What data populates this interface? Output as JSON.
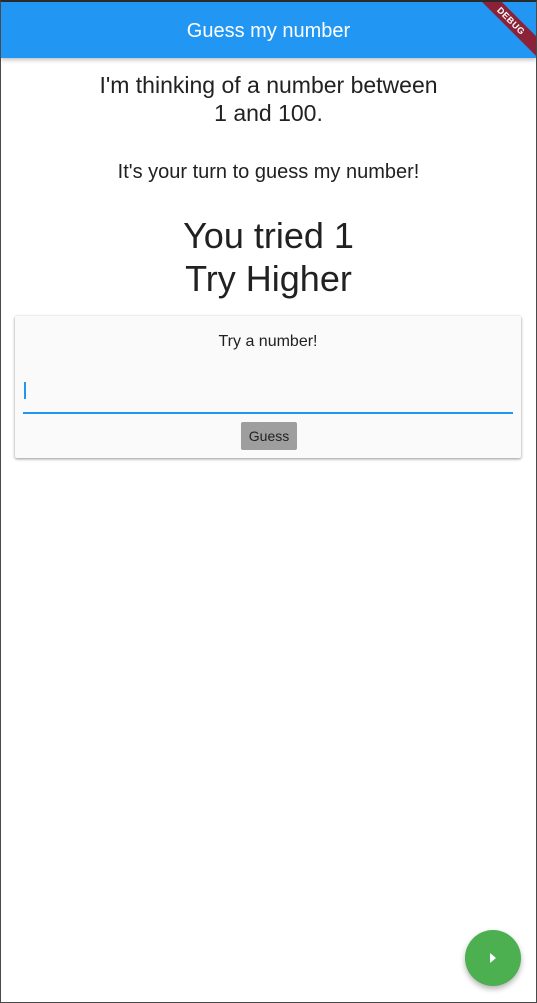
{
  "app_bar": {
    "title": "Guess my number",
    "debug_banner": "DEBUG",
    "color": "#2196f3"
  },
  "main": {
    "intro_line1": "I'm thinking of a number between",
    "intro_line2": "1 and 100.",
    "turn_prompt": "It's your turn to guess my number!",
    "result_line1": "You tried 1",
    "result_line2": "Try Higher"
  },
  "guess_card": {
    "title": "Try a number!",
    "input_value": "",
    "input_placeholder": "",
    "button_label": "Guess"
  },
  "fab": {
    "icon": "play-arrow-icon",
    "color": "#4caf50"
  }
}
